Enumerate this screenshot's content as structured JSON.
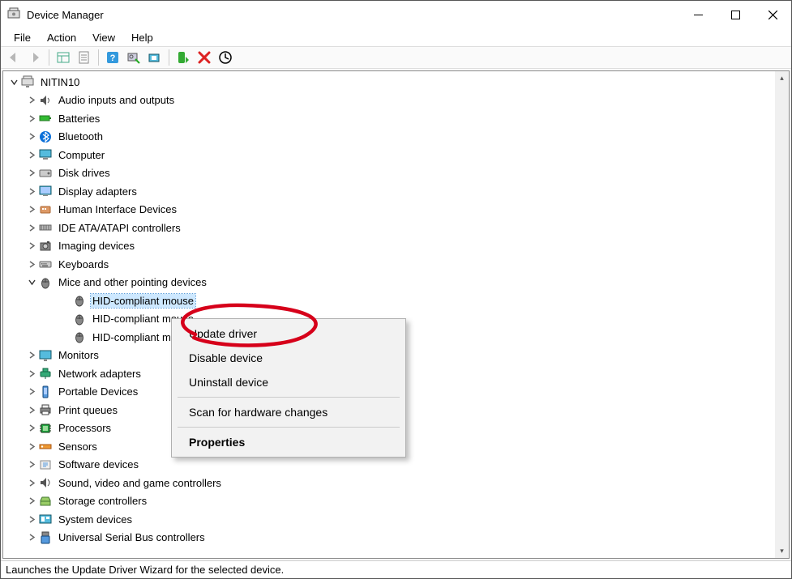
{
  "window": {
    "title": "Device Manager"
  },
  "menu": {
    "file": "File",
    "action": "Action",
    "view": "View",
    "help": "Help"
  },
  "tree": {
    "root": "NITIN10",
    "categories": [
      {
        "label": "Audio inputs and outputs",
        "icon": "audio"
      },
      {
        "label": "Batteries",
        "icon": "battery"
      },
      {
        "label": "Bluetooth",
        "icon": "bluetooth"
      },
      {
        "label": "Computer",
        "icon": "computer"
      },
      {
        "label": "Disk drives",
        "icon": "disk"
      },
      {
        "label": "Display adapters",
        "icon": "display"
      },
      {
        "label": "Human Interface Devices",
        "icon": "hid"
      },
      {
        "label": "IDE ATA/ATAPI controllers",
        "icon": "ide"
      },
      {
        "label": "Imaging devices",
        "icon": "imaging"
      },
      {
        "label": "Keyboards",
        "icon": "keyboard"
      },
      {
        "label": "Mice and other pointing devices",
        "icon": "mouse",
        "expanded": true,
        "children": [
          {
            "label": "HID-compliant mouse",
            "icon": "mouse",
            "selected": true
          },
          {
            "label": "HID-compliant mouse",
            "icon": "mouse"
          },
          {
            "label": "HID-compliant mouse",
            "icon": "mouse"
          }
        ]
      },
      {
        "label": "Monitors",
        "icon": "monitor"
      },
      {
        "label": "Network adapters",
        "icon": "network"
      },
      {
        "label": "Portable Devices",
        "icon": "portable"
      },
      {
        "label": "Print queues",
        "icon": "printer"
      },
      {
        "label": "Processors",
        "icon": "processor"
      },
      {
        "label": "Sensors",
        "icon": "sensor"
      },
      {
        "label": "Software devices",
        "icon": "software"
      },
      {
        "label": "Sound, video and game controllers",
        "icon": "sound"
      },
      {
        "label": "Storage controllers",
        "icon": "storage"
      },
      {
        "label": "System devices",
        "icon": "system"
      },
      {
        "label": "Universal Serial Bus controllers",
        "icon": "usb"
      }
    ]
  },
  "context_menu": {
    "update": "Update driver",
    "disable": "Disable device",
    "uninstall": "Uninstall device",
    "scan": "Scan for hardware changes",
    "properties": "Properties"
  },
  "status": "Launches the Update Driver Wizard for the selected device."
}
